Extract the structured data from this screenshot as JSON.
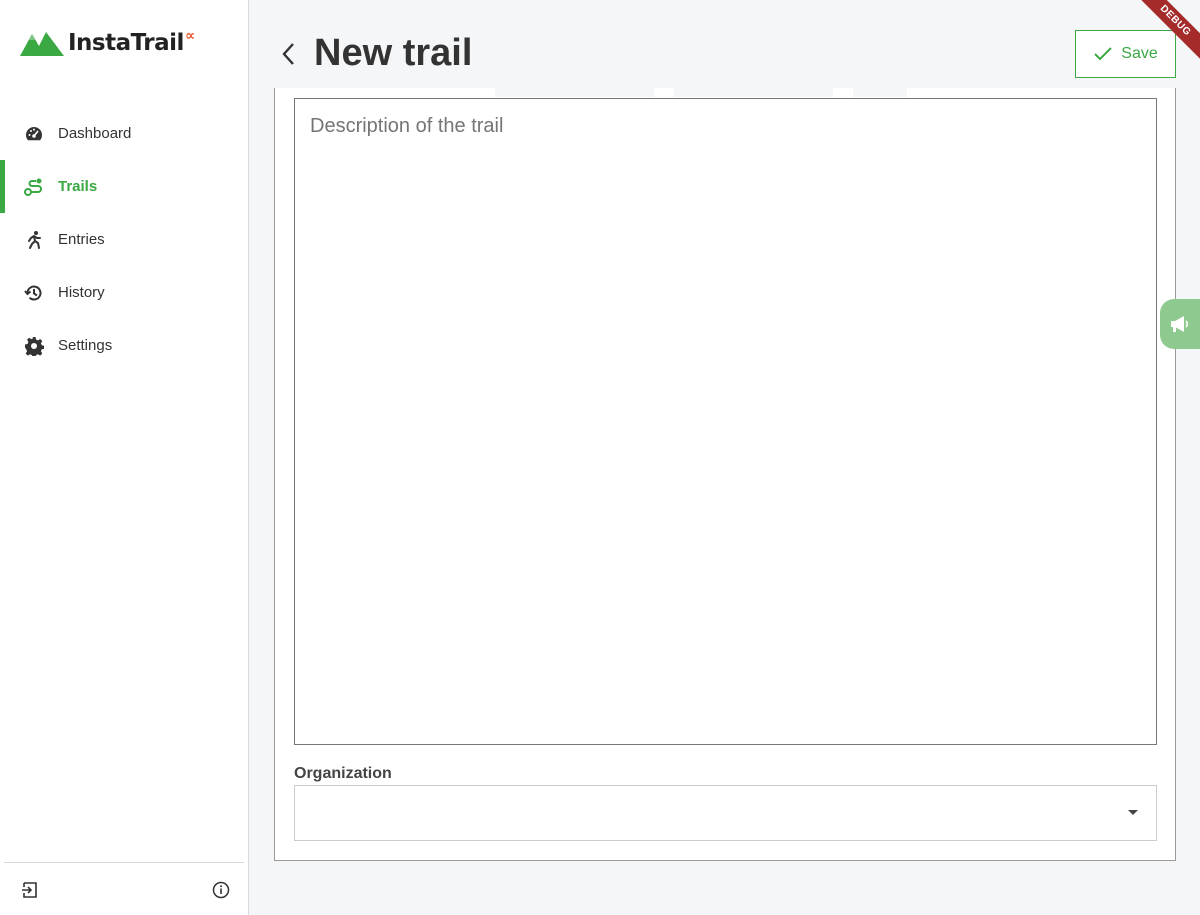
{
  "app": {
    "name": "InstaTrail",
    "name_suffix": "∝",
    "brand_color": "#3aa843",
    "accent_color": "#e8522b"
  },
  "sidebar": {
    "items": [
      {
        "label": "Dashboard",
        "icon": "gauge-icon",
        "active": false
      },
      {
        "label": "Trails",
        "icon": "route-icon",
        "active": true
      },
      {
        "label": "Entries",
        "icon": "running-person-icon",
        "active": false
      },
      {
        "label": "History",
        "icon": "history-icon",
        "active": false
      },
      {
        "label": "Settings",
        "icon": "gear-icon",
        "active": false
      }
    ],
    "footer": {
      "logout_icon": "logout-icon",
      "info_icon": "info-icon"
    }
  },
  "header": {
    "title": "New trail",
    "save_label": "Save",
    "debug_label": "DEBUG"
  },
  "form": {
    "description": {
      "placeholder": "Description of the trail",
      "value": ""
    },
    "organization": {
      "label": "Organization",
      "value": ""
    }
  },
  "feedback": {
    "icon": "megaphone-icon"
  }
}
